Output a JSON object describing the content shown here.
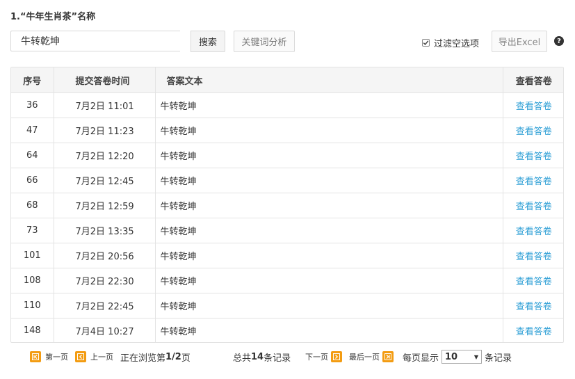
{
  "question_title": "1.“牛年生肖茶”名称",
  "search": {
    "value": "牛转乾坤",
    "button": "搜索"
  },
  "keyword_button": "关键词分析",
  "filter": {
    "label": "过滤空选项",
    "checked": true
  },
  "export_button": "导出Excel",
  "help_icon": "question-circle-icon",
  "table": {
    "headers": [
      "序号",
      "提交答卷时间",
      "答案文本",
      "查看答卷"
    ],
    "rows": [
      {
        "id": "36",
        "time": "7月2日 11:01",
        "answer": "牛转乾坤",
        "view": "查看答卷"
      },
      {
        "id": "47",
        "time": "7月2日 11:23",
        "answer": "牛转乾坤",
        "view": "查看答卷"
      },
      {
        "id": "64",
        "time": "7月2日 12:20",
        "answer": "牛转乾坤",
        "view": "查看答卷"
      },
      {
        "id": "66",
        "time": "7月2日 12:45",
        "answer": "牛转乾坤",
        "view": "查看答卷"
      },
      {
        "id": "68",
        "time": "7月2日 12:59",
        "answer": "牛转乾坤",
        "view": "查看答卷"
      },
      {
        "id": "73",
        "time": "7月2日 13:35",
        "answer": "牛转乾坤",
        "view": "查看答卷"
      },
      {
        "id": "101",
        "time": "7月2日 20:56",
        "answer": "牛转乾坤",
        "view": "查看答卷"
      },
      {
        "id": "108",
        "time": "7月2日 22:30",
        "answer": "牛转乾坤",
        "view": "查看答卷"
      },
      {
        "id": "110",
        "time": "7月2日 22:45",
        "answer": "牛转乾坤",
        "view": "查看答卷"
      },
      {
        "id": "148",
        "time": "7月4日 10:27",
        "answer": "牛转乾坤",
        "view": "查看答卷"
      }
    ]
  },
  "pager": {
    "first": "第一页",
    "prev": "上一页",
    "browsing_prefix": "正在浏览第",
    "browsing_page": "1/2",
    "browsing_suffix": "页",
    "total_prefix": "总共",
    "total_count": "14",
    "total_suffix": "条记录",
    "next": "下一页",
    "last": "最后一页",
    "per_page_label": "每页显示",
    "per_page_value": "10",
    "records_label": "条记录"
  },
  "colors": {
    "accent_link": "#2e9fd6",
    "pager_icon": "#f39c12"
  }
}
